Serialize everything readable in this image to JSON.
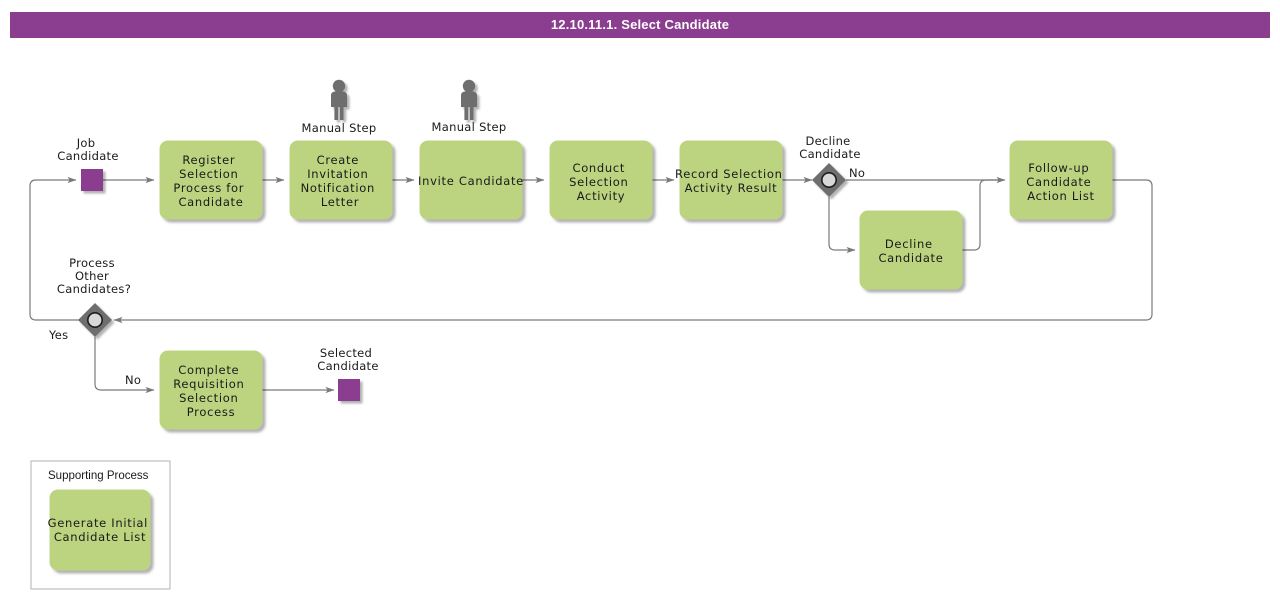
{
  "title": "12.10.11.1. Select Candidate",
  "colors": {
    "banner": "#8b3d8f",
    "task_fill": "#bcd47f",
    "task_stroke": "#a8c36a",
    "event_fill": "#8b3d8f",
    "gateway_fill": "#6e6e6e",
    "connector": "#7a7a7a",
    "manual_icon": "#6e6e6e",
    "group_stroke": "#b3b3b3"
  },
  "events": [
    {
      "id": "start",
      "label": "Job\nCandidate",
      "label_lines": [
        "Job",
        "Candidate"
      ],
      "shape": "square"
    },
    {
      "id": "end",
      "label": "Selected\nCandidate",
      "label_lines": [
        "Selected",
        "Candidate"
      ],
      "shape": "square"
    }
  ],
  "tasks": [
    {
      "id": "register",
      "lines": [
        "Register",
        "Selection",
        "Process for",
        "Candidate"
      ],
      "marker": null
    },
    {
      "id": "create-letter",
      "lines": [
        "Create",
        "Invitation",
        "Notification",
        "Letter"
      ],
      "marker": "Manual Step"
    },
    {
      "id": "invite",
      "lines": [
        "Invite Candidate"
      ],
      "marker": "Manual Step"
    },
    {
      "id": "conduct",
      "lines": [
        "Conduct",
        "Selection",
        "Activity"
      ],
      "marker": null
    },
    {
      "id": "record",
      "lines": [
        "Record Selection",
        "Activity Result"
      ],
      "marker": null
    },
    {
      "id": "decline",
      "lines": [
        "Decline",
        "Candidate"
      ],
      "marker": null
    },
    {
      "id": "followup",
      "lines": [
        "Follow-up",
        "Candidate",
        "Action List"
      ],
      "marker": null
    },
    {
      "id": "complete",
      "lines": [
        "Complete",
        "Requisition",
        "Selection",
        "Process"
      ],
      "marker": null
    },
    {
      "id": "generate",
      "lines": [
        "Generate Initial",
        "Candidate List"
      ],
      "marker": null
    }
  ],
  "gateways": [
    {
      "id": "decline-gw",
      "label_lines": [
        "Decline",
        "Candidate"
      ],
      "branches": [
        "No"
      ]
    },
    {
      "id": "other-gw",
      "label_lines": [
        "Process",
        "Other",
        "Candidates?"
      ],
      "branches": [
        "Yes",
        "No"
      ]
    }
  ],
  "group": {
    "title": "Supporting Process"
  },
  "markers": {
    "manual_step": "Manual Step"
  },
  "conditions": {
    "no_top": "No",
    "yes": "Yes",
    "no_bottom": "No"
  }
}
